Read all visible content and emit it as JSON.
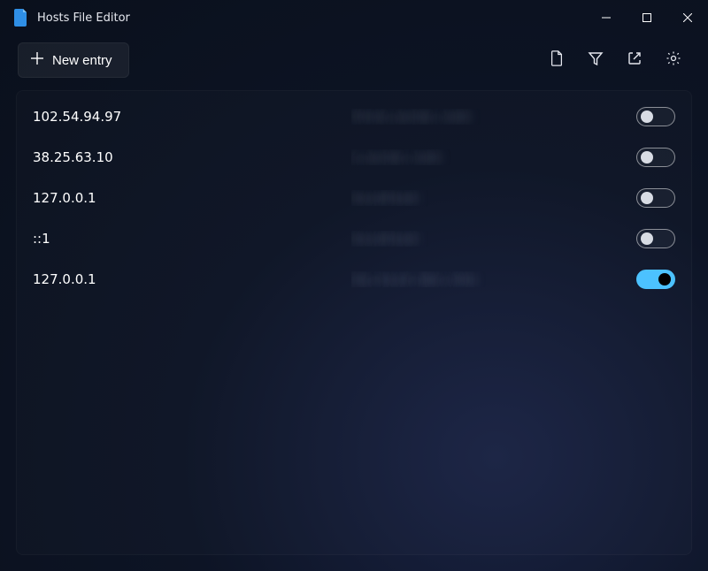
{
  "titlebar": {
    "title": "Hosts File Editor"
  },
  "toolbar": {
    "new_entry_label": "New entry"
  },
  "entries": [
    {
      "ip": "102.54.94.97",
      "hostname": "rhino.acme.com",
      "enabled": false
    },
    {
      "ip": "38.25.63.10",
      "hostname": "x.acme.com",
      "enabled": false
    },
    {
      "ip": "127.0.0.1",
      "hostname": "localhost",
      "enabled": false
    },
    {
      "ip": "::1",
      "hostname": "localhost",
      "enabled": false
    },
    {
      "ip": "127.0.0.1",
      "hostname": "my.local.dev.site",
      "enabled": true
    }
  ],
  "colors": {
    "accent": "#4cc2ff"
  }
}
